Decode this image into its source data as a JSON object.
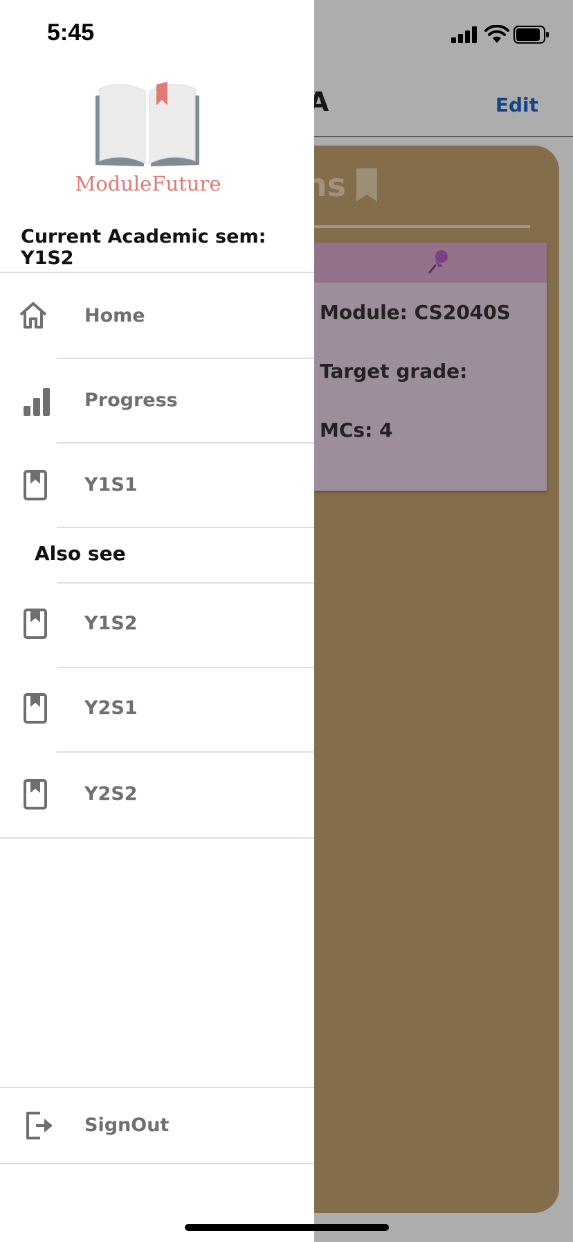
{
  "status_bar": {
    "time": "5:45"
  },
  "background": {
    "header_title": "an A",
    "edit_button": "Edit",
    "section_title": "ns",
    "card": {
      "module_label": "Module: CS2040S",
      "target_grade_label": "Target grade:",
      "mcs_label": "MCs: 4"
    }
  },
  "drawer": {
    "brand_name": "ModuleFuture",
    "current_sem": "Current Academic sem: Y1S2",
    "items": [
      {
        "label": "Home",
        "icon": "home-icon"
      },
      {
        "label": "Progress",
        "icon": "bar-chart-icon"
      },
      {
        "label": "Y1S1",
        "icon": "book-icon"
      }
    ],
    "also_see_label": "Also see",
    "also_see_items": [
      {
        "label": "Y1S2",
        "icon": "book-icon"
      },
      {
        "label": "Y2S1",
        "icon": "book-icon"
      },
      {
        "label": "Y2S2",
        "icon": "book-icon"
      }
    ],
    "signout_label": "SignOut"
  },
  "colors": {
    "brand": "#e07a76",
    "link": "#1e63c7",
    "board": "#c2a16d",
    "card": "#e6d1e3"
  }
}
